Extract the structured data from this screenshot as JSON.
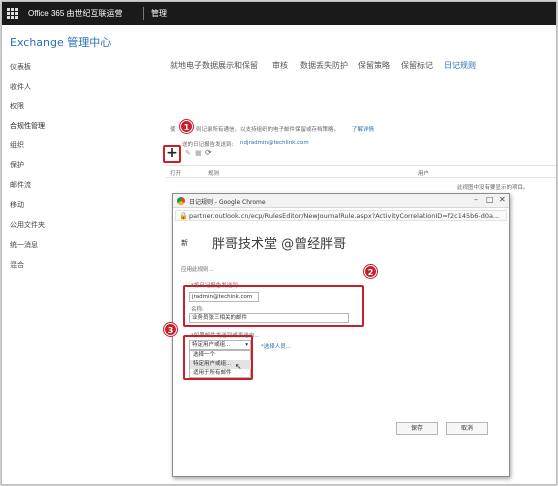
{
  "topbar": {
    "brand": "Office 365 由世纪互联运营",
    "admin": "管理"
  },
  "app": {
    "title": "Exchange 管理中心"
  },
  "nav": {
    "items": [
      {
        "label": "仪表板"
      },
      {
        "label": "收件人"
      },
      {
        "label": "权限"
      },
      {
        "label": "合规性管理"
      },
      {
        "label": "组织"
      },
      {
        "label": "保护"
      },
      {
        "label": "邮件流"
      },
      {
        "label": "移动"
      },
      {
        "label": "公用文件夹"
      },
      {
        "label": "统一消息"
      },
      {
        "label": "混合"
      }
    ]
  },
  "tabs": [
    {
      "label": "就地电子数据展示和保留"
    },
    {
      "label": "审核"
    },
    {
      "label": "数据丢失防护"
    },
    {
      "label": "保留策略"
    },
    {
      "label": "保留标记"
    },
    {
      "label": "日记规则"
    }
  ],
  "content": {
    "description_start": "使",
    "description": "则记录所有通信，以支持组织的电子邮件保留或存档策略。",
    "learn_more": "了解详情",
    "report_prefix": "送的日记报告发送到:",
    "report_email": "ndjradmin@techlink.com",
    "col_on": "打开",
    "col_rule": "规则",
    "col_user": "用户",
    "empty_msg": "此视图中没有要显示的项目。"
  },
  "dialog": {
    "title": "日记规则 - Google Chrome",
    "url": "partner.outlook.cn/ecp/RulesEditor/NewJournalRule.aspx?ActivityCorrelationID=f2c145b6-d0a...",
    "heading": "新",
    "apply_label": "应用此规则...",
    "send_label": "*将日记报告发送到:",
    "send_value": "jradmin@techink.com",
    "name_label": "名称:",
    "name_value": "业务员张三相关的邮件",
    "scope_label": "*如果邮件发送到或发送自...",
    "scope_selected": "特定用户或组...",
    "select_people": "*选择人员...",
    "options": [
      "选择一个",
      "特定用户或组...",
      "适用于所有邮件"
    ],
    "save": "保存",
    "cancel": "取消"
  },
  "annotations": {
    "b1": "1",
    "b2": "2",
    "b3": "3"
  },
  "watermark": "胖哥技术堂 @曾经胖哥",
  "colors": {
    "accent": "#2a6fb5",
    "annotation": "#c8202b",
    "topbar": "#1a1a1a"
  }
}
